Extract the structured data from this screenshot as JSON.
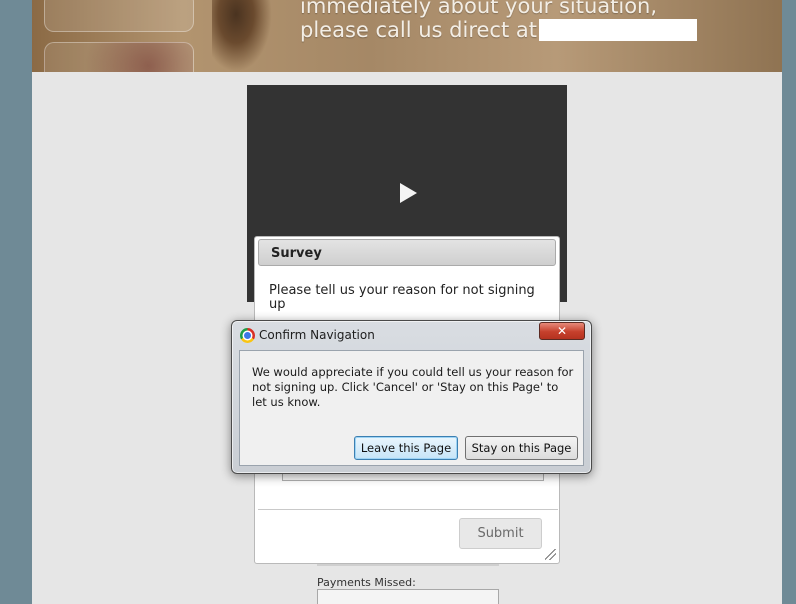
{
  "banner": {
    "line1": "immediately about your situation,",
    "line2": "please call us direct at"
  },
  "survey": {
    "title": "Survey",
    "question": "Please tell us your reason for not signing up",
    "submit_label": "Submit"
  },
  "form": {
    "payments_missed_label": "Payments Missed:"
  },
  "dialog": {
    "title": "Confirm Navigation",
    "close_label": "✕",
    "message": "We would appreciate if you could tell us your reason for not signing up. Click 'Cancel' or 'Stay on this Page' to let us know.",
    "leave_label": "Leave this Page",
    "stay_label": "Stay on this Page"
  },
  "icons": {
    "browser": "chrome-icon",
    "play": "play-icon",
    "close": "close-icon",
    "resize": "resize-grip-icon"
  },
  "colors": {
    "page_background": "#6f8a96",
    "content_background": "#e6e6e6",
    "video_background": "#333333",
    "close_button": "#c6402c",
    "default_button_accent": "#3c7fb1"
  }
}
